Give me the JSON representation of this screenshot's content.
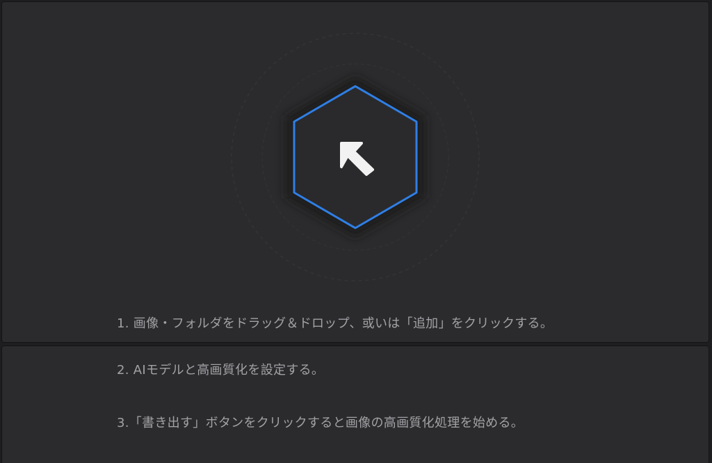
{
  "drop_zone": {
    "icon": "arrow-up-left-icon",
    "accent_color": "#2f7fe6"
  },
  "instructions": [
    {
      "text": "1.  画像・フォルダをドラッグ＆ドロップ、或いは「追加」をクリックする。"
    },
    {
      "text": "2.  AIモデルと高画質化を設定する。"
    },
    {
      "text": "3.「書き出す」ボタンをクリックすると画像の高画質化処理を始める。"
    }
  ]
}
